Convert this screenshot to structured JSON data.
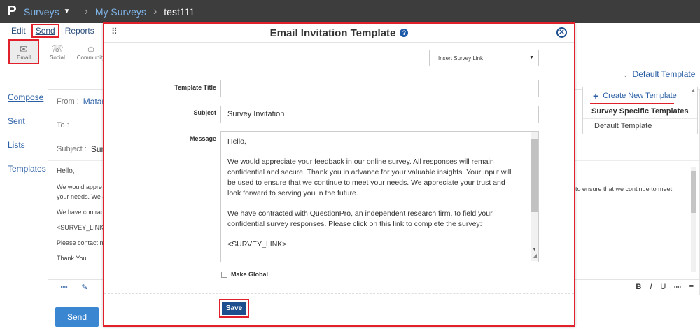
{
  "topbar": {
    "logo": "P",
    "surveys": "Surveys",
    "my_surveys": "My Surveys",
    "current": "test111"
  },
  "subnav": {
    "edit": "Edit",
    "send": "Send",
    "reports": "Reports"
  },
  "channels": [
    {
      "label": "Email",
      "icon": "envelope-icon"
    },
    {
      "label": "Social",
      "icon": "chat-icon"
    },
    {
      "label": "Community",
      "icon": "people-icon"
    }
  ],
  "sidenav": [
    "Compose",
    "Sent",
    "Lists",
    "Templates"
  ],
  "bg_form": {
    "from_label": "From :",
    "from_value": "Matan",
    "to_label": "To :",
    "subject_label": "Subject :",
    "subject_value": "Sur",
    "body": [
      "Hello,",
      "We would appre",
      "your needs. We a",
      "We have contract",
      "<SURVEY_LINK>",
      "Please contact n",
      "Thank You"
    ],
    "right_text": "to ensure that we continue to meet"
  },
  "default_template": "Default Template",
  "template_panel": {
    "create": "Create New Template",
    "group": "Survey Specific Templates",
    "option": "Default Template"
  },
  "send_button": "Send",
  "modal": {
    "title": "Email Invitation Template",
    "insert_link": "Insert Survey Link",
    "template_title_label": "Template Title",
    "template_title_value": "",
    "subject_label": "Subject",
    "subject_value": "Survey Invitation",
    "message_label": "Message",
    "message": [
      "Hello,",
      "We would appreciate your feedback in our online survey.  All responses will remain confidential and secure.  Thank you in advance for your valuable insights.  Your input will be used to ensure that we continue to meet your needs. We appreciate your trust and look forward to serving you in the future.",
      "We have contracted with QuestionPro, an independent research firm, to field your confidential survey responses.  Please click on this link to complete the survey:",
      "<SURVEY_LINK>"
    ],
    "make_global": "Make Global",
    "save": "Save"
  },
  "colors": {
    "highlight": "#e0202a",
    "primary": "#1d4f8f",
    "link": "#2a5fa5",
    "send_button": "#3b86d1"
  }
}
